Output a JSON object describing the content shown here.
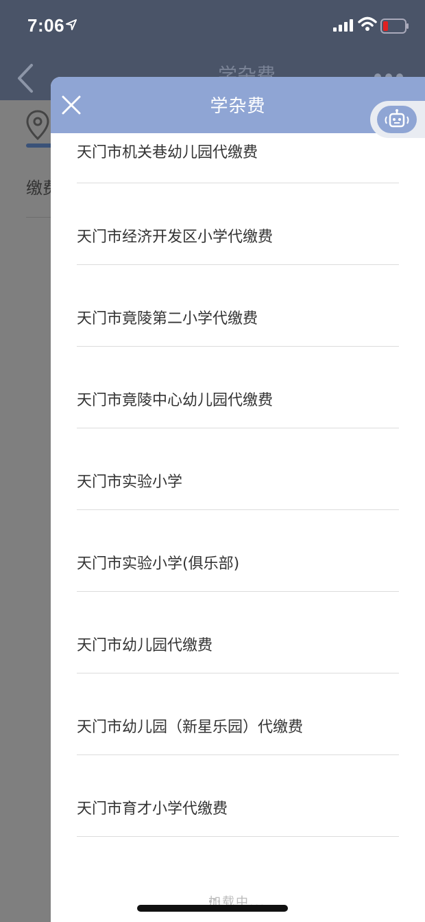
{
  "status_bar": {
    "time": "7:06"
  },
  "background": {
    "title": "学杂费",
    "label": "缴费"
  },
  "sheet": {
    "title": "学杂费",
    "items": [
      "天门市机关巷幼儿园代缴费",
      "天门市经济开发区小学代缴费",
      "天门市竟陵第二小学代缴费",
      "天门市竟陵中心幼儿园代缴费",
      "天门市实验小学",
      "天门市实验小学(俱乐部)",
      "天门市幼儿园代缴费",
      "天门市幼儿园（新星乐园）代缴费",
      "天门市育才小学代缴费"
    ],
    "loading_text": "加载中..."
  },
  "colors": {
    "header": "#8fa5d4",
    "status_bg": "#4a5468"
  }
}
